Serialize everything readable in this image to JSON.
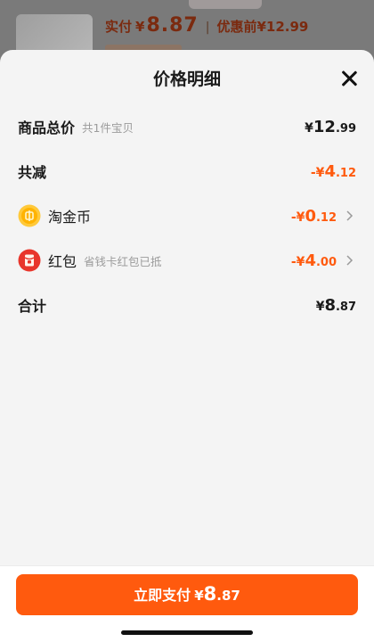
{
  "background": {
    "pay_label": "实付",
    "currency": "¥",
    "pay_amount": "8.87",
    "separator": "|",
    "original_label": "优惠前",
    "original_amount": "¥12.99"
  },
  "sheet": {
    "title": "价格明细",
    "rows": [
      {
        "label": "商品总价",
        "sub": "共1件宝贝",
        "sym": "¥",
        "int": "12",
        "dec": ".99"
      },
      {
        "label": "共减",
        "sym": "-¥",
        "int": "4",
        "dec": ".12"
      },
      {
        "label": "淘金币",
        "icon": "gold-coin-icon",
        "sym": "-¥",
        "int": "0",
        "dec": ".12"
      },
      {
        "label": "红包",
        "sub": "省钱卡红包已抵",
        "icon": "red-envelope-icon",
        "sym": "-¥",
        "int": "4",
        "dec": ".00"
      },
      {
        "label": "合计",
        "sym": "¥",
        "int": "8",
        "dec": ".87"
      }
    ]
  },
  "footer": {
    "pay_label": "立即支付",
    "sym": "¥",
    "int": "8",
    "dec": ".87"
  },
  "colors": {
    "accent": "#ff5a0e",
    "text": "#1a1a1a",
    "muted": "#9b9b9b"
  }
}
